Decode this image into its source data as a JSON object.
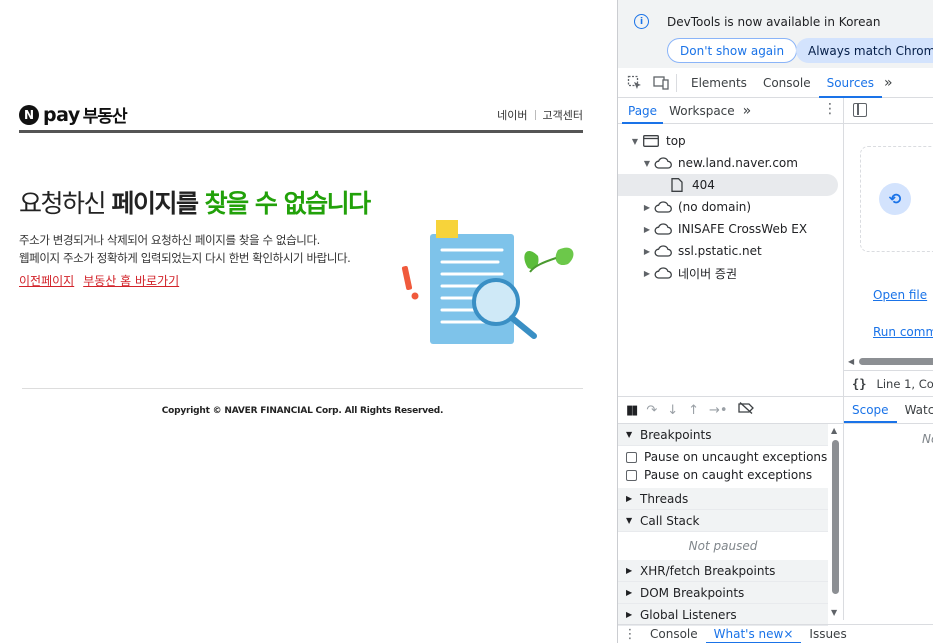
{
  "page": {
    "logo": {
      "badge": "N",
      "pay": "pay",
      "brand": "부동산"
    },
    "top_links": [
      "네이버",
      "고객센터"
    ],
    "headline": {
      "part1": "요청하신 ",
      "part2": "페이지를",
      "part3": " 찾을 수 없습니다"
    },
    "description": [
      "주소가 변경되거나 삭제되어 요청하신 페이지를 찾을 수 없습니다.",
      "웹페이지 주소가 정확하게 입력되었는지 다시 한번 확인하시기 바랍니다."
    ],
    "links": {
      "prev": "이전페이지",
      "home": "부동산 홈 바로가기"
    },
    "copyright": "Copyright © NAVER FINANCIAL Corp.  All Rights Reserved.",
    "colors": {
      "accent_green": "#22a10a",
      "link_red": "#d2232a"
    }
  },
  "devtools": {
    "infobar": {
      "message": "DevTools is now available in Korean",
      "dont_show": "Don't show again",
      "always_match": "Always match Chrome's"
    },
    "main_tabs": [
      "Elements",
      "Console",
      "Sources"
    ],
    "active_main_tab": "Sources",
    "more": "»",
    "sub_tabs": [
      "Page",
      "Workspace"
    ],
    "tree": [
      {
        "label": "top",
        "icon": "frame-icon",
        "expanded": true
      },
      {
        "label": "new.land.naver.com",
        "icon": "cloud-icon",
        "expanded": true
      },
      {
        "label": "404",
        "icon": "file-icon",
        "selected": true
      },
      {
        "label": "(no domain)",
        "icon": "cloud-icon"
      },
      {
        "label": "INISAFE CrossWeb EX",
        "icon": "cloud-icon"
      },
      {
        "label": "ssl.pstatic.net",
        "icon": "cloud-icon"
      },
      {
        "label": "네이버 증권",
        "icon": "cloud-icon"
      }
    ],
    "editor": {
      "open_file": "Open file",
      "run_command": "Run comma",
      "status": "Line 1, Co",
      "braces": "{}"
    },
    "debugger": {
      "breakpoints": "Breakpoints",
      "pause_uncaught": "Pause on uncaught exceptions",
      "pause_caught": "Pause on caught exceptions",
      "threads": "Threads",
      "call_stack": "Call Stack",
      "not_paused": "Not paused",
      "xhr": "XHR/fetch Breakpoints",
      "dom": "DOM Breakpoints",
      "global": "Global Listeners"
    },
    "scope_tabs": [
      "Scope",
      "Watch"
    ],
    "scope_empty": "No",
    "drawer": {
      "console": "Console",
      "whats_new": "What's new",
      "close": "×",
      "issues": "Issues"
    }
  }
}
